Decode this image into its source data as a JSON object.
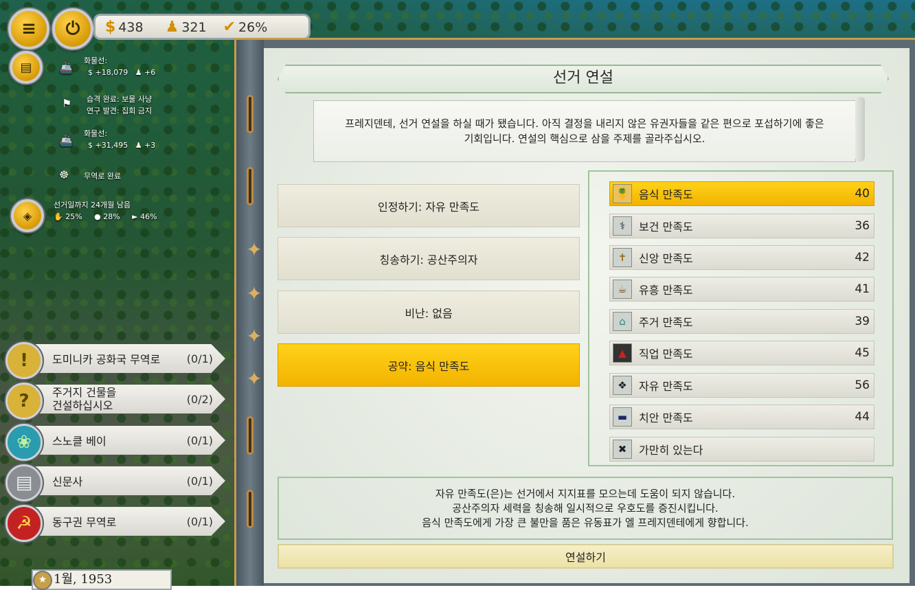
{
  "resources": {
    "money": "438",
    "population": "321",
    "approval": "26%"
  },
  "feed": [
    {
      "title": "화물선:",
      "money": "+18,079",
      "people": "+6"
    },
    {
      "line1": "습격 완료: 보물 사냥",
      "line2": "연구 발견: 집회 금지"
    },
    {
      "title": "화물선:",
      "money": "+31,495",
      "people": "+3"
    },
    {
      "text": "무역로 완료"
    }
  ],
  "election": {
    "text": "선거일까지 24개월 남음",
    "v1": "25%",
    "v2": "28%",
    "v3": "46%"
  },
  "quests": [
    {
      "label": "도미니카 공화국 무역로",
      "count": "(0/1)",
      "icon": "exclamation-icon",
      "color": "#d9b23a"
    },
    {
      "label": "주거지 건물을\n건설하십시오",
      "count": "(0/2)",
      "icon": "question-icon",
      "color": "#d9b23a"
    },
    {
      "label": "스노클 베이",
      "count": "(0/1)",
      "icon": "leaf-icon",
      "color": "#2a9cb0"
    },
    {
      "label": "신문사",
      "count": "(0/1)",
      "icon": "newspaper-icon",
      "color": "#8a8e92"
    },
    {
      "label": "동구권 무역로",
      "count": "(0/1)",
      "icon": "hammer-sickle-icon",
      "color": "#c42222"
    }
  ],
  "date": "1월, 1953",
  "dialog": {
    "title": "선거 연설",
    "intro": "프레지덴테, 선거 연설을 하실 때가 됐습니다. 아직 결정을 내리지 않은 유권자들을 같은 편으로 포섭하기에 좋은 기회입니다. 연설의 핵심으로 삼을 주제를 골라주십시오.",
    "options": [
      {
        "label": "인정하기: 자유 만족도",
        "selected": false
      },
      {
        "label": "칭송하기: 공산주의자",
        "selected": false
      },
      {
        "label": "비난: 없음",
        "selected": false
      },
      {
        "label": "공약: 음식 만족도",
        "selected": true
      }
    ],
    "topics": [
      {
        "label": "음식 만족도",
        "value": "40",
        "icon": "pineapple-icon",
        "selected": true
      },
      {
        "label": "보건 만족도",
        "value": "36",
        "icon": "stethoscope-icon",
        "selected": false
      },
      {
        "label": "신앙 만족도",
        "value": "42",
        "icon": "cross-icon",
        "selected": false
      },
      {
        "label": "유흥 만족도",
        "value": "41",
        "icon": "coconut-drink-icon",
        "selected": false
      },
      {
        "label": "주거 만족도",
        "value": "39",
        "icon": "house-icon",
        "selected": false
      },
      {
        "label": "직업 만족도",
        "value": "45",
        "icon": "suit-icon",
        "selected": false
      },
      {
        "label": "자유 만족도",
        "value": "56",
        "icon": "eagle-icon",
        "selected": false
      },
      {
        "label": "치안 만족도",
        "value": "44",
        "icon": "police-cap-icon",
        "selected": false
      },
      {
        "label": "가만히 있는다",
        "value": "",
        "icon": "crossed-swords-icon",
        "selected": false
      }
    ],
    "info_lines": [
      "자유 만족도(은)는 선거에서 지지표를 모으는데 도움이 되지 않습니다.",
      "공산주의자 세력을 칭송해 일시적으로 우호도를 증진시킵니다.",
      "음식 만족도에게 가장 큰 불만을 품은 유동표가 엘 프레지덴테에게 향합니다."
    ],
    "speak_button": "연설하기"
  }
}
